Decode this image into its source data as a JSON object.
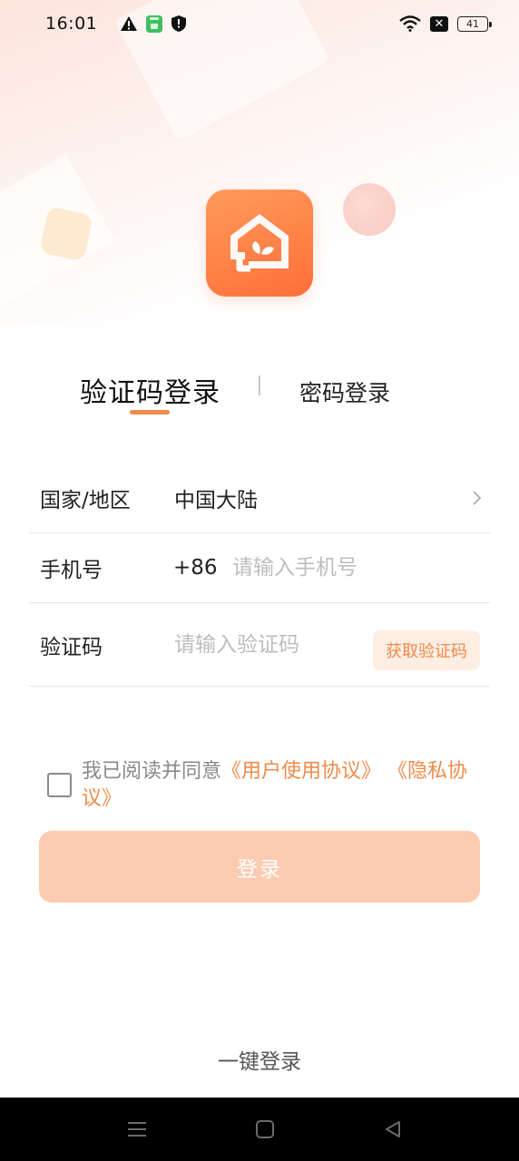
{
  "status_bar": {
    "time": "16:01",
    "icons": [
      "warning-icon",
      "app-notification-icon",
      "shield-icon",
      "wifi-icon",
      "no-sim-icon",
      "battery-icon"
    ],
    "battery_level": "41"
  },
  "logo": {
    "icon": "home-leaf-icon",
    "colors": [
      "#ff9a5a",
      "#ff6f3a"
    ]
  },
  "tabs": {
    "active": "验证码登录",
    "inactive": "密码登录"
  },
  "form": {
    "region": {
      "label": "国家/地区",
      "value": "中国大陆"
    },
    "phone": {
      "label": "手机号",
      "country_code": "+86",
      "placeholder": "请输入手机号"
    },
    "code": {
      "label": "验证码",
      "placeholder": "请输入验证码",
      "get_code_label": "获取验证码"
    }
  },
  "agreement": {
    "prefix": "我已阅读并同意",
    "user_agreement": "《用户使用协议》",
    "privacy_policy": "《隐私协议》",
    "checked": false
  },
  "login_button": {
    "label": "登录"
  },
  "one_key_login": "一键登录",
  "colors": {
    "accent": "#f08a4b",
    "button_disabled": "#fccbb1"
  }
}
